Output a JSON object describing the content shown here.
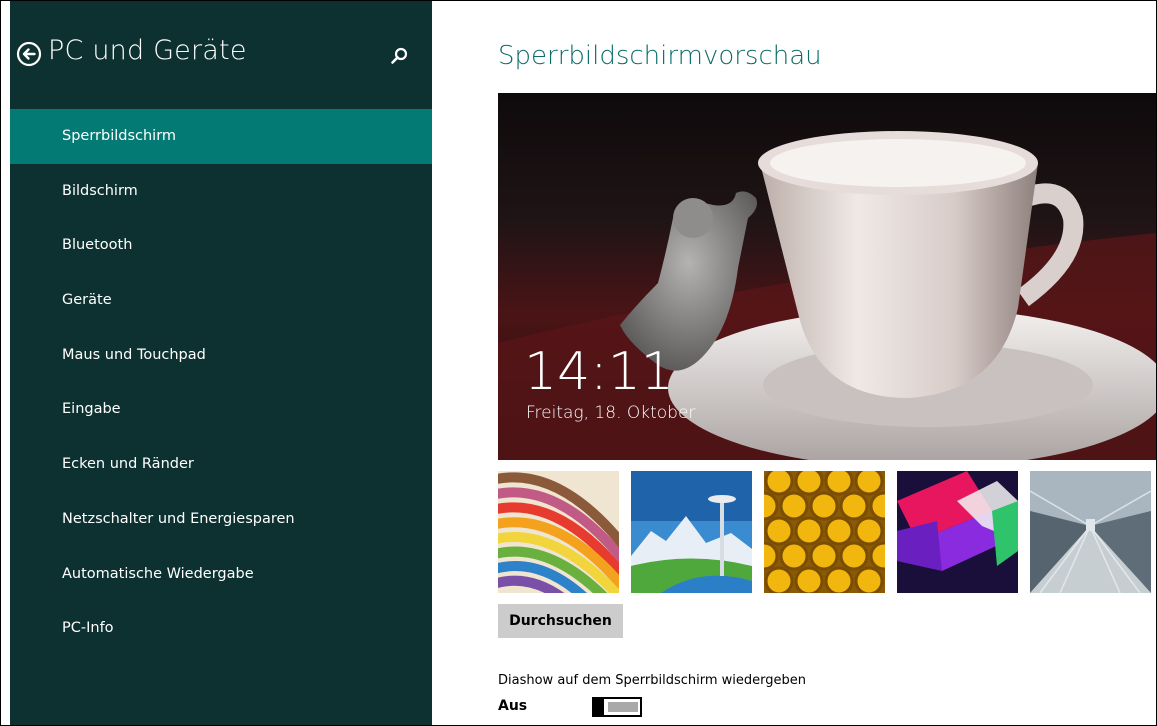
{
  "sidebar": {
    "title": "PC und Geräte",
    "back_icon": "back-arrow-circle-icon",
    "search_icon": "search-icon",
    "items": [
      {
        "label": "Sperrbildschirm",
        "selected": true
      },
      {
        "label": "Bildschirm",
        "selected": false
      },
      {
        "label": "Bluetooth",
        "selected": false
      },
      {
        "label": "Geräte",
        "selected": false
      },
      {
        "label": "Maus und Touchpad",
        "selected": false
      },
      {
        "label": "Eingabe",
        "selected": false
      },
      {
        "label": "Ecken und Ränder",
        "selected": false
      },
      {
        "label": "Netzschalter und Energiesparen",
        "selected": false
      },
      {
        "label": "Automatische Wiedergabe",
        "selected": false
      },
      {
        "label": "PC-Info",
        "selected": false
      }
    ]
  },
  "main": {
    "title": "Sperrbildschirmvorschau",
    "preview": {
      "time": "14:11",
      "date": "Freitag, 18. Oktober"
    },
    "thumbnails": [
      "colored-pencils-image",
      "space-needle-image",
      "honeycomb-image",
      "abstract-shapes-image",
      "train-tunnel-image"
    ],
    "browse_label": "Durchsuchen",
    "slideshow_label": "Diashow auf dem Sperrbildschirm wiedergeben",
    "toggle_state_label": "Aus",
    "toggle_on": false
  },
  "colors": {
    "sidebar_bg": "#0c3130",
    "selected_bg": "#047a74",
    "accent_title": "#0a6d68"
  }
}
